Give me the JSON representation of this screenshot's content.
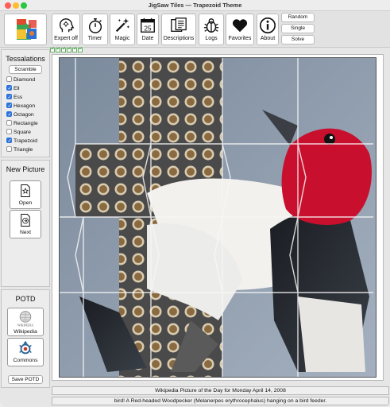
{
  "window": {
    "title": "JigSaw Tiles — Trapezoid Theme"
  },
  "toolbar": {
    "buttons": [
      {
        "label": "Expert off",
        "icon": "expert-head-icon"
      },
      {
        "label": "Timer",
        "icon": "stopwatch-icon"
      },
      {
        "label": "Magic",
        "icon": "magic-wand-icon"
      },
      {
        "label": "Date",
        "icon": "calendar-icon",
        "day": "25"
      },
      {
        "label": "Descriptions",
        "icon": "descriptions-icon"
      },
      {
        "label": "Logs",
        "icon": "bug-icon"
      },
      {
        "label": "Favorites",
        "icon": "heart-icon"
      },
      {
        "label": "About",
        "icon": "info-icon"
      }
    ],
    "right_buttons": [
      "Random",
      "Single",
      "Solve"
    ]
  },
  "sidebar": {
    "tessalations": {
      "title": "Tessalations",
      "scramble_label": "Scramble",
      "options": [
        {
          "label": "Diamond",
          "checked": false
        },
        {
          "label": "Ell",
          "checked": true
        },
        {
          "label": "Ess",
          "checked": true
        },
        {
          "label": "Hexagon",
          "checked": true
        },
        {
          "label": "Octagon",
          "checked": true
        },
        {
          "label": "Rectangle",
          "checked": false
        },
        {
          "label": "Square",
          "checked": false
        },
        {
          "label": "Trapezoid",
          "checked": true
        },
        {
          "label": "Triangle",
          "checked": false
        }
      ]
    },
    "new_picture": {
      "title": "New Picture",
      "open_label": "Open",
      "next_label": "Next"
    },
    "potd": {
      "title": "POTD",
      "wikipedia_label": "Wikipedia",
      "wikipedia_logo_text": "WIKIPEDIA",
      "commons_label": "Commons",
      "save_label": "Save POTD"
    }
  },
  "status": {
    "line1": "Wikipedia Picture of the Day for Monday April 14, 2008",
    "line2": "bird! A Red-headed Woodpecker (Melanerpes erythrocephalus) hanging on a bird feeder."
  },
  "colors": {
    "accent": "#2e73d9",
    "head_red": "#c8102e",
    "sky": "#8a99ab"
  }
}
